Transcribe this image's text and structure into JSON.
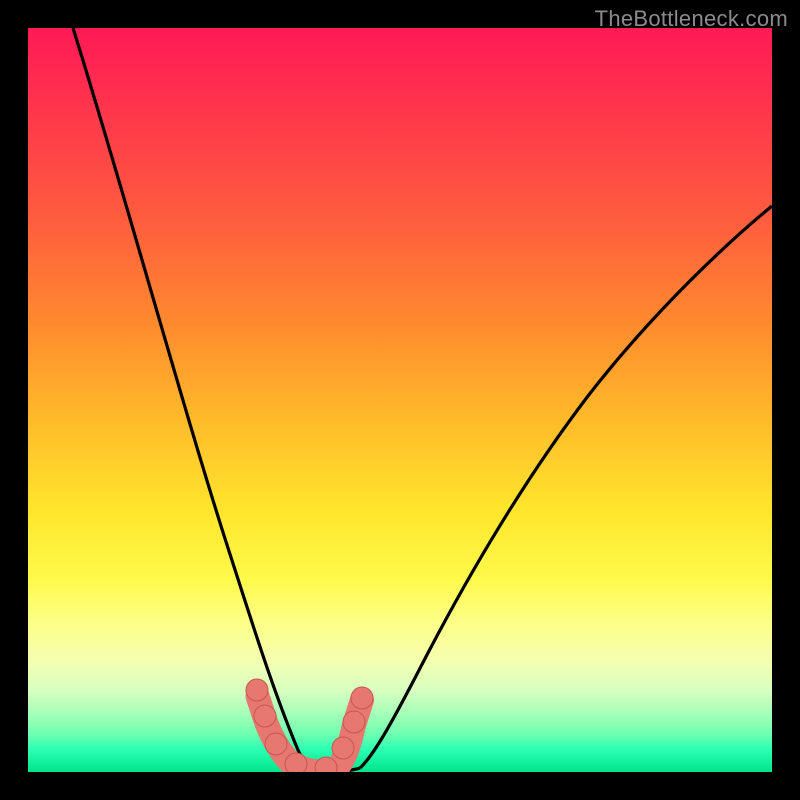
{
  "watermark": "TheBottleneck.com",
  "colors": {
    "frame": "#000000",
    "curve_stroke": "#000000",
    "badge_fill": "#e6786f",
    "badge_stroke": "#c7564e",
    "gradient": [
      "#ff1a55",
      "#ff2e4f",
      "#ff5a3f",
      "#ff8b2e",
      "#ffb82a",
      "#ffe62c",
      "#fff94a",
      "#fcff88",
      "#f4ffb0",
      "#d8ffc0",
      "#a8ffb8",
      "#6cffb0",
      "#2bffb2",
      "#00e58a"
    ]
  },
  "chart_data": {
    "type": "line",
    "title": "",
    "xlabel": "",
    "ylabel": "",
    "xlim": [
      0,
      100
    ],
    "ylim": [
      0,
      100
    ],
    "legend": "off",
    "grid": "off",
    "curve_left_percent": [
      {
        "x": 6.0,
        "y": 100.0
      },
      {
        "x": 9.5,
        "y": 88.0
      },
      {
        "x": 13.0,
        "y": 76.0
      },
      {
        "x": 16.5,
        "y": 64.0
      },
      {
        "x": 20.0,
        "y": 52.0
      },
      {
        "x": 23.0,
        "y": 40.0
      },
      {
        "x": 25.5,
        "y": 31.0
      },
      {
        "x": 27.5,
        "y": 23.0
      },
      {
        "x": 29.5,
        "y": 16.0
      },
      {
        "x": 31.0,
        "y": 10.0
      },
      {
        "x": 32.5,
        "y": 5.5
      },
      {
        "x": 34.0,
        "y": 2.5
      },
      {
        "x": 36.0,
        "y": 0.5
      }
    ],
    "curve_right_percent": [
      {
        "x": 40.0,
        "y": 0.5
      },
      {
        "x": 42.0,
        "y": 1.5
      },
      {
        "x": 44.0,
        "y": 4.5
      },
      {
        "x": 47.0,
        "y": 10.0
      },
      {
        "x": 51.0,
        "y": 18.0
      },
      {
        "x": 56.0,
        "y": 27.0
      },
      {
        "x": 62.0,
        "y": 37.0
      },
      {
        "x": 70.0,
        "y": 48.0
      },
      {
        "x": 79.0,
        "y": 58.5
      },
      {
        "x": 90.0,
        "y": 68.5
      },
      {
        "x": 100.0,
        "y": 76.0
      }
    ],
    "sweet_spot_percent": [
      {
        "x": 31.0,
        "y": 10.5
      },
      {
        "x": 32.0,
        "y": 7.0
      },
      {
        "x": 33.5,
        "y": 3.2
      },
      {
        "x": 36.0,
        "y": 0.8
      },
      {
        "x": 40.0,
        "y": 0.8
      },
      {
        "x": 42.0,
        "y": 2.8
      },
      {
        "x": 43.8,
        "y": 6.4
      },
      {
        "x": 44.8,
        "y": 9.5
      }
    ]
  }
}
